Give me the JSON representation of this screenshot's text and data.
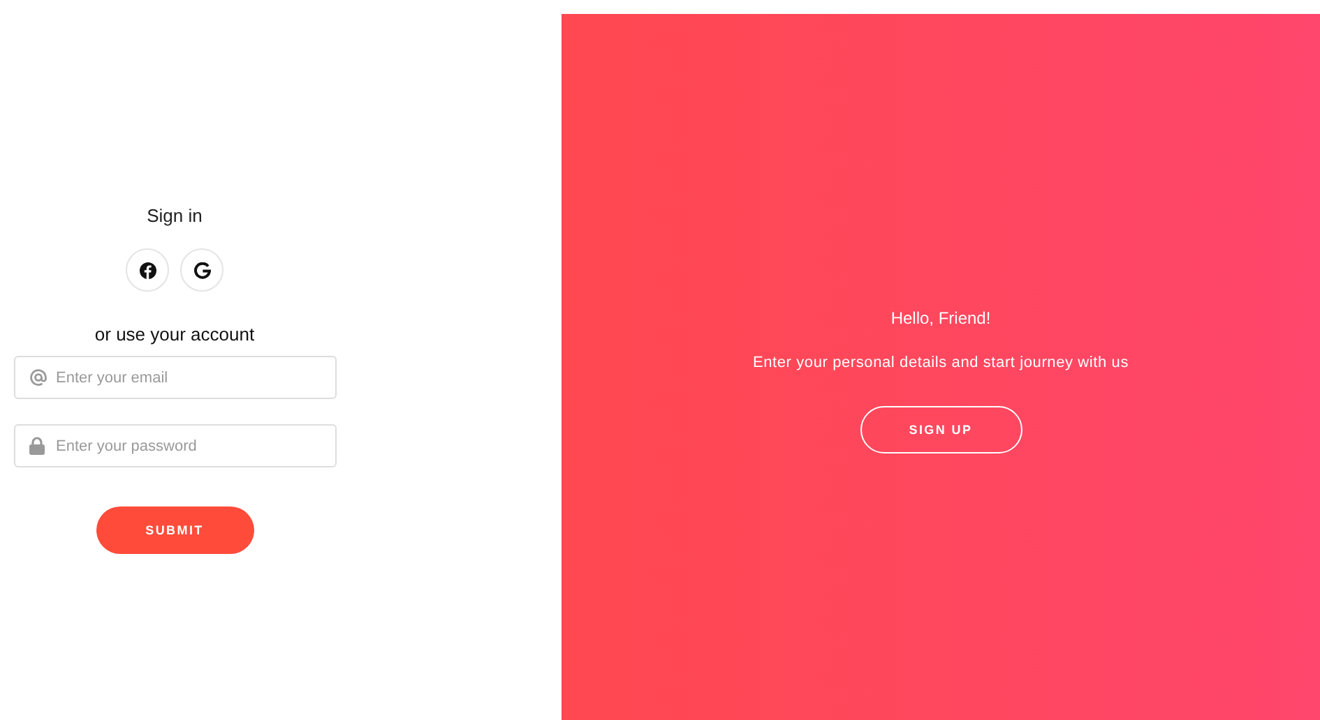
{
  "sign_in": {
    "title": "Sign in",
    "social_buttons": [
      {
        "kind": "facebook"
      },
      {
        "kind": "google"
      }
    ],
    "alt_text": "or use your account",
    "fields": [
      {
        "kind": "email",
        "placeholder": "Enter your email"
      },
      {
        "kind": "password",
        "placeholder": "Enter your password"
      }
    ],
    "submit": "SUBMIT"
  },
  "overlay": {
    "title": "Hello, Friend!",
    "text": "Enter your personal details and start journey with us",
    "button": "SIGN UP"
  }
}
